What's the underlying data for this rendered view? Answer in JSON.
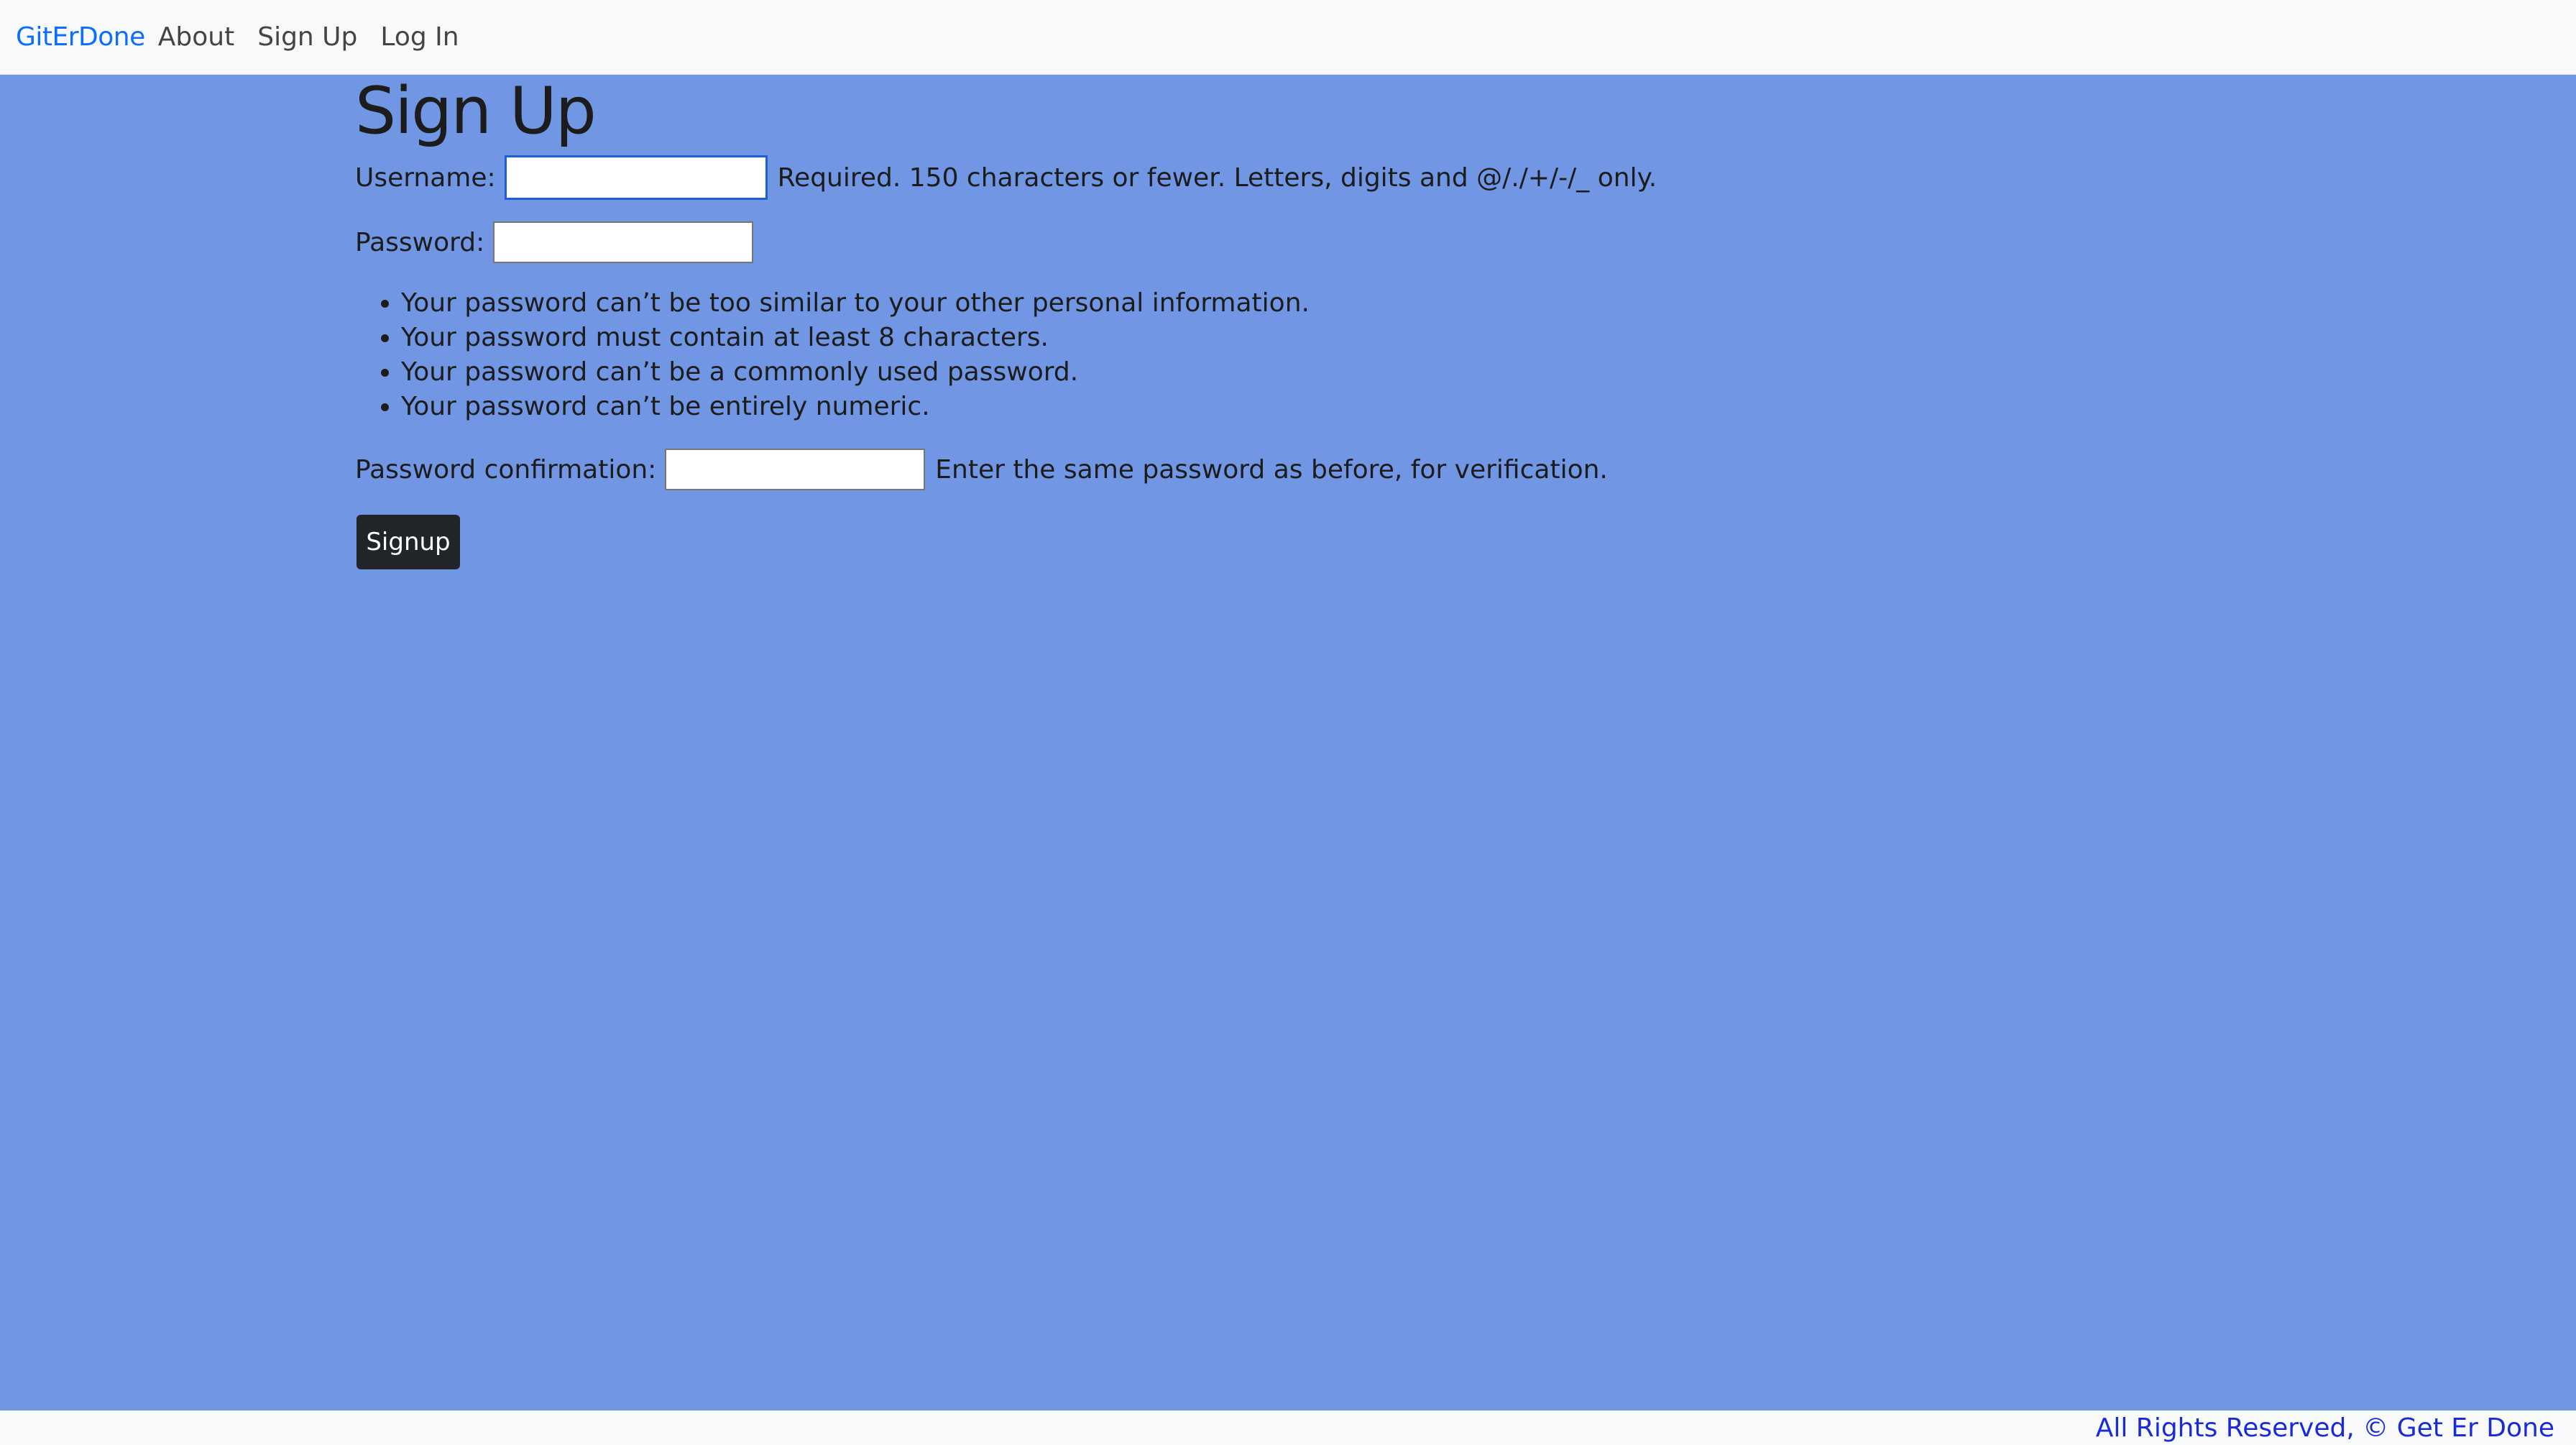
{
  "nav": {
    "brand": "GitErDone",
    "links": [
      {
        "label": "About"
      },
      {
        "label": "Sign Up"
      },
      {
        "label": "Log In"
      }
    ]
  },
  "page": {
    "title": "Sign Up"
  },
  "form": {
    "username": {
      "label": "Username:",
      "value": "",
      "help": "Required. 150 characters or fewer. Letters, digits and @/./+/-/_ only."
    },
    "password": {
      "label": "Password:",
      "value": "",
      "rules": [
        "Your password can’t be too similar to your other personal information.",
        "Your password must contain at least 8 characters.",
        "Your password can’t be a commonly used password.",
        "Your password can’t be entirely numeric."
      ]
    },
    "password_confirmation": {
      "label": "Password confirmation:",
      "value": "",
      "help": "Enter the same password as before, for verification."
    },
    "submit_label": "Signup"
  },
  "footer": {
    "text": "All Rights Reserved, © Get Er Done"
  },
  "colors": {
    "background": "#7096e4",
    "navbar": "#f8f9fa",
    "brand": "#0d6efd",
    "button": "#212529",
    "footer_text": "#1a2bd6"
  }
}
